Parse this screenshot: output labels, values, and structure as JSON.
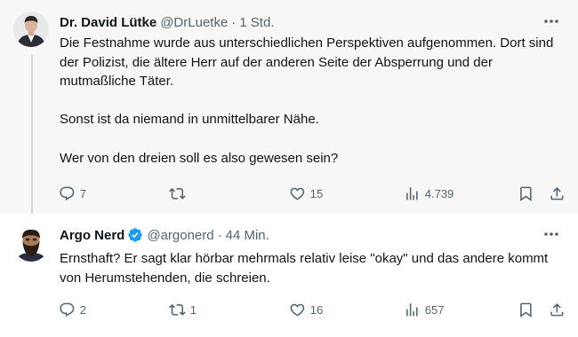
{
  "tweets": [
    {
      "author": {
        "name": "Dr. David Lütke",
        "handle": "@DrLuetke",
        "verified": false
      },
      "separator": "·",
      "time": "1 Std.",
      "paragraphs": [
        "Die Festnahme wurde aus unterschiedlichen Perspektiven aufgenommen. Dort sind der Polizist, die ältere Herr auf der anderen Seite der Absperrung und der mutmaßliche Täter.",
        "Sonst ist da niemand in unmittelbarer Nähe.",
        "Wer von den dreien soll es also gewesen sein?"
      ],
      "stats": {
        "replies": "7",
        "reposts": "",
        "likes": "15",
        "views": "4.739"
      }
    },
    {
      "author": {
        "name": "Argo Nerd",
        "handle": "@argonerd",
        "verified": true
      },
      "separator": "·",
      "time": "44 Min.",
      "paragraphs": [
        "Ernsthaft? Er sagt klar hörbar mehrmals relativ leise \"okay\" und das andere kommt von Herumstehenden, die schreien."
      ],
      "stats": {
        "replies": "2",
        "reposts": "1",
        "likes": "16",
        "views": "657"
      }
    }
  ],
  "icons": {
    "more": "more-horizontal-icon",
    "reply": "reply-icon",
    "repost": "repost-icon",
    "like": "heart-icon",
    "views": "views-chart-icon",
    "bookmark": "bookmark-icon",
    "share": "share-icon",
    "verified": "verified-badge-icon"
  },
  "colors": {
    "text": "#0f1419",
    "muted": "#536471",
    "verified_blue": "#1d9bf0",
    "thread_line": "#cfd9de",
    "first_tweet_bg": "#f7f7f7"
  }
}
